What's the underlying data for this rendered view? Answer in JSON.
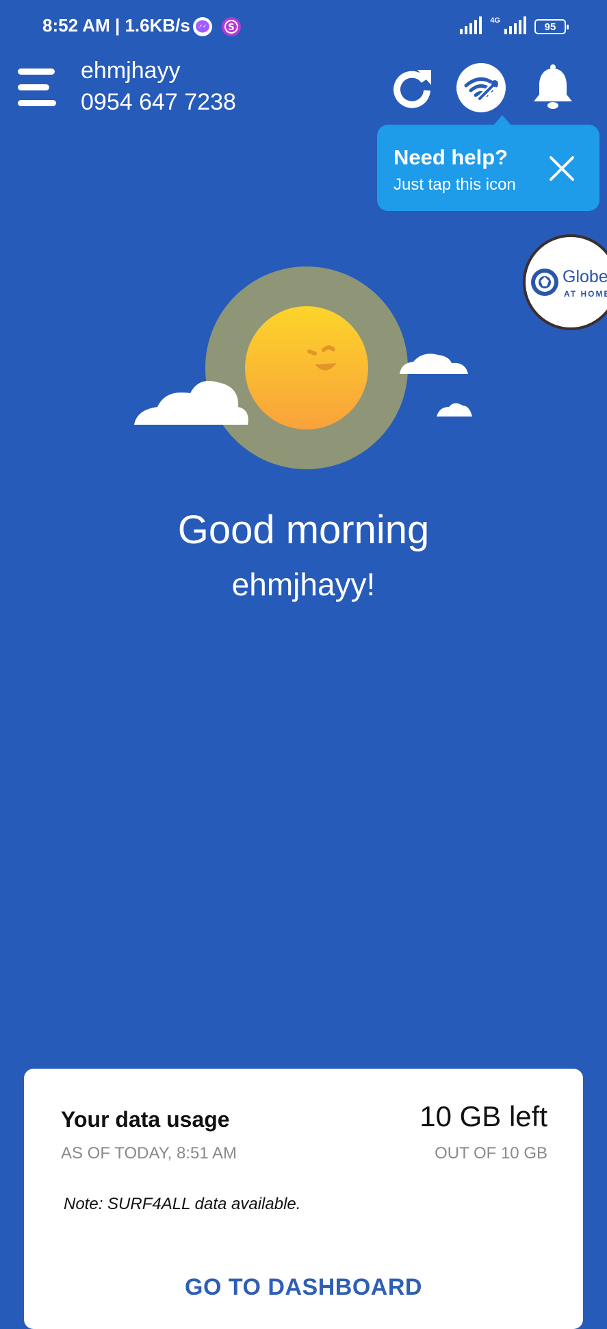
{
  "status_bar": {
    "time": "8:52 AM | 1.6KB/s",
    "network_type": "4G",
    "battery": "95"
  },
  "header": {
    "user_name": "ehmjhayy",
    "phone_number": "0954 647 7238"
  },
  "tooltip": {
    "title": "Need help?",
    "subtitle": "Just tap this icon"
  },
  "globe_badge": {
    "brand": "Globe",
    "tagline": "AT HOME"
  },
  "greeting": {
    "line1": "Good morning",
    "line2": "ehmjhayy!"
  },
  "data_card": {
    "title": "Your data usage",
    "as_of": "AS OF TODAY, 8:51 AM",
    "remaining": "10 GB left",
    "out_of": "OUT OF 10 GB",
    "note": "Note: SURF4ALL data available.",
    "cta": "GO TO DASHBOARD"
  },
  "colors": {
    "background": "#275bb9",
    "tooltip": "#1e9be9",
    "cta_text": "#2f5fb5",
    "sun_halo": "#8f9677",
    "sun": "#fbc02d"
  },
  "icons": [
    "menu-icon",
    "refresh-icon",
    "wifi-help-icon",
    "bell-icon",
    "close-icon",
    "messenger-icon",
    "app-s-icon",
    "signal-icon",
    "battery-icon"
  ]
}
